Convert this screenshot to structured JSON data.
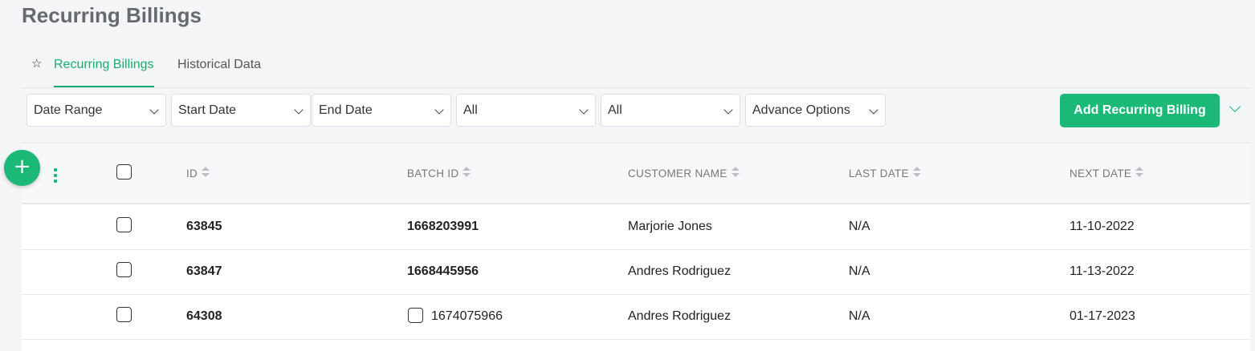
{
  "page": {
    "title": "Recurring Billings"
  },
  "tabs": [
    {
      "label": "Recurring Billings",
      "active": true
    },
    {
      "label": "Historical Data",
      "active": false
    }
  ],
  "filters": [
    {
      "value": "Date Range"
    },
    {
      "value": "Start Date"
    },
    {
      "value": "End Date"
    },
    {
      "value": "All"
    },
    {
      "value": "All"
    },
    {
      "value": "Advance Options"
    }
  ],
  "actions": {
    "add_label": "Add Recurring Billing"
  },
  "fab": {
    "symbol": "+"
  },
  "table": {
    "columns": [
      "ID",
      "BATCH ID",
      "CUSTOMER NAME",
      "LAST DATE",
      "NEXT DATE"
    ],
    "rows": [
      {
        "id": "63845",
        "batch_id": "1668203991",
        "customer": "Marjorie Jones",
        "last_date": "N/A",
        "next_date": "11-10-2022"
      },
      {
        "id": "63847",
        "batch_id": "1668445956",
        "customer": "Andres Rodriguez",
        "last_date": "N/A",
        "next_date": "11-13-2022"
      },
      {
        "id": "64308",
        "batch_id": "1674075966",
        "customer": "Andres Rodriguez",
        "last_date": "N/A",
        "next_date": "01-17-2023"
      }
    ]
  },
  "colors": {
    "accent": "#1cb878",
    "title": "#666a70"
  }
}
